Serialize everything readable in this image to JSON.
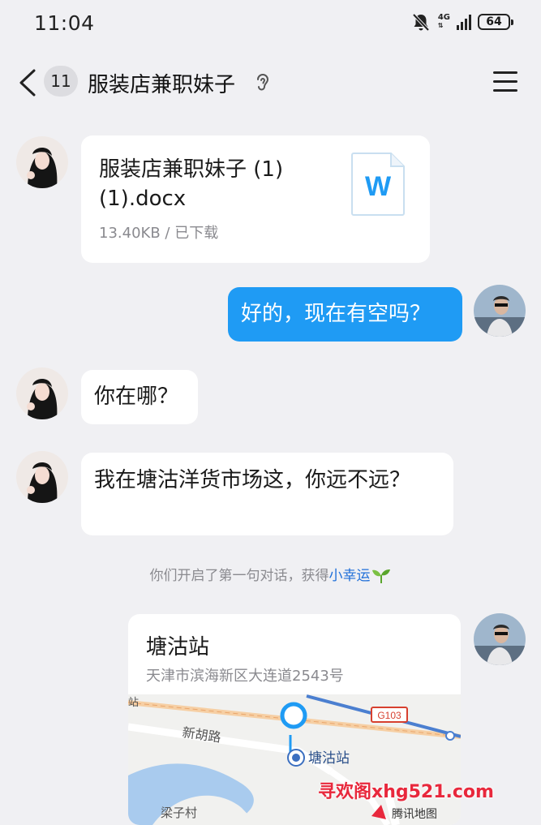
{
  "status_bar": {
    "time": "11:04",
    "network": "4G",
    "battery": "64"
  },
  "header": {
    "unread_count": "11",
    "title": "服装店兼职妹子"
  },
  "messages": [
    {
      "from": "other",
      "type": "file",
      "file_name": "服装店兼职妹子 (1)(1).docx",
      "file_meta": "13.40KB / 已下载",
      "file_icon_letter": "W"
    },
    {
      "from": "me",
      "type": "text",
      "text": "好的，现在有空吗？"
    },
    {
      "from": "other",
      "type": "text",
      "text": "你在哪？"
    },
    {
      "from": "other",
      "type": "text",
      "text": "我在塘沽洋货市场这，你远不远？"
    }
  ],
  "system_notice": {
    "text": "你们开启了第一句对话，获得",
    "highlight": "小幸运"
  },
  "location": {
    "name": "塘沽站",
    "address": "天津市滨海新区大连道2543号",
    "map_labels": {
      "road": "新胡路",
      "station": "塘沽站",
      "highway": "G103",
      "village": "梁子村",
      "brand": "腾讯地图",
      "edge": "站"
    }
  },
  "watermark": "寻欢阁xhg521.com",
  "colors": {
    "accent": "#1f9bf4",
    "background": "#f0f0f3",
    "link": "#1f6fd9"
  }
}
